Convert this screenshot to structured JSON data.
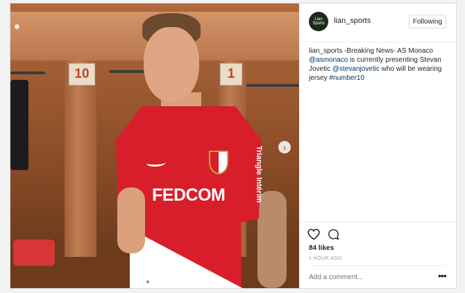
{
  "post": {
    "username": "lian_sports",
    "avatar_text": "Lian Sports",
    "follow_label": "Following",
    "caption": {
      "author": "lian_sports",
      "text_1": " -Breaking News- AS Monaco ",
      "mention_1": "@asmonaco",
      "text_2": " is currently presenting Stevan Jovetic ",
      "mention_2": "@stevanjovetic",
      "text_3": " who will be wearing jersey ",
      "hashtag": "#number10"
    },
    "likes": "84 likes",
    "time": "1 HOUR AGO",
    "comment_placeholder": "Add a comment...",
    "more_label": "•••"
  },
  "photo": {
    "locker_left": "10",
    "locker_right": "1",
    "sponsor": "FEDCOM",
    "sleeve_text": "Triangle Intérim",
    "carousel": {
      "count": 3,
      "active": 1
    }
  },
  "icons": {
    "heart": "heart-icon",
    "comment": "comment-icon",
    "next": "chevron-right-icon"
  },
  "colors": {
    "link": "#003569",
    "jersey_red": "#d81e2a",
    "carousel_active": "#4f9ad9"
  }
}
